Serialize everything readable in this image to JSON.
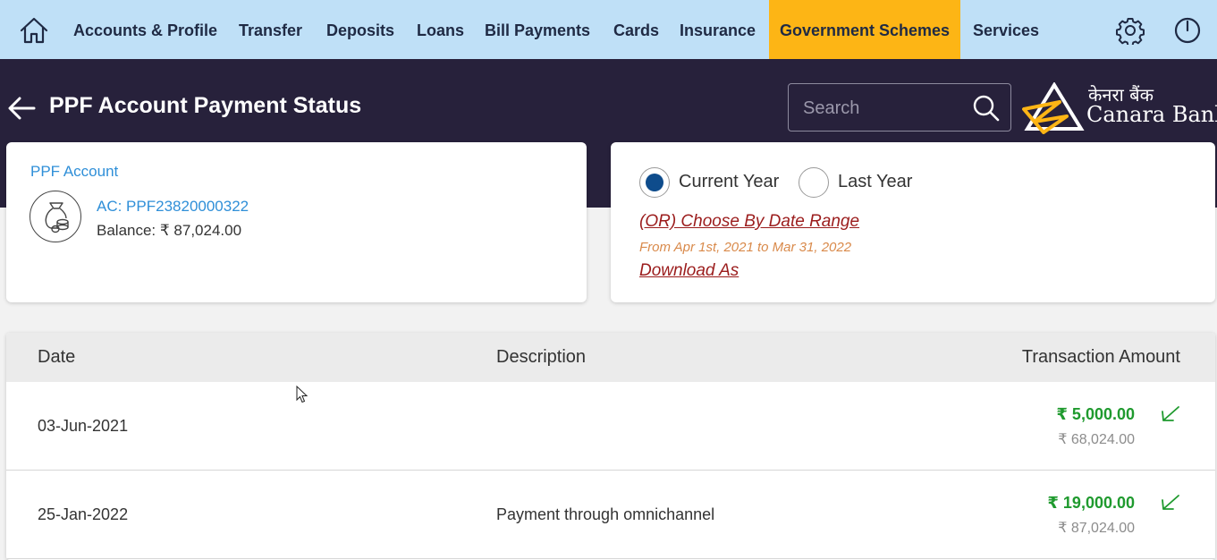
{
  "nav": {
    "items": [
      {
        "label": "Accounts & Profile"
      },
      {
        "label": "Transfer"
      },
      {
        "label": "Deposits"
      },
      {
        "label": "Loans"
      },
      {
        "label": "Bill Payments"
      },
      {
        "label": "Cards"
      },
      {
        "label": "Insurance"
      },
      {
        "label": "Government Schemes",
        "active": true
      },
      {
        "label": "Services"
      }
    ],
    "active_color": "#fdb515",
    "bg_color": "#bfe0f7"
  },
  "header": {
    "title": "PPF Account Payment Status",
    "search_placeholder": "Search",
    "logo_hindi": "केनरा बैंक",
    "logo_name": "Canara Bank",
    "bg_color": "#27213b"
  },
  "account": {
    "type": "PPF Account",
    "number": "AC: PPF23820000322",
    "balance": "Balance: ₹  87,024.00"
  },
  "filter": {
    "options": [
      {
        "label": "Current Year",
        "checked": true
      },
      {
        "label": "Last Year",
        "checked": false
      }
    ],
    "date_range_link": "(OR) Choose By Date Range",
    "date_range_text": "From Apr 1st, 2021 to Mar 31, 2022",
    "download_link": "Download As"
  },
  "table": {
    "headers": {
      "date": "Date",
      "description": "Description",
      "amount": "Transaction Amount"
    },
    "rows": [
      {
        "date": "03-Jun-2021",
        "description": "",
        "amount": "₹ 5,000.00",
        "balance": "₹  68,024.00",
        "direction": "credit"
      },
      {
        "date": "25-Jan-2022",
        "description": "Payment through omnichannel",
        "amount": "₹ 19,000.00",
        "balance": "₹  87,024.00",
        "direction": "credit"
      }
    ],
    "credit_color": "#1f9a2e"
  }
}
